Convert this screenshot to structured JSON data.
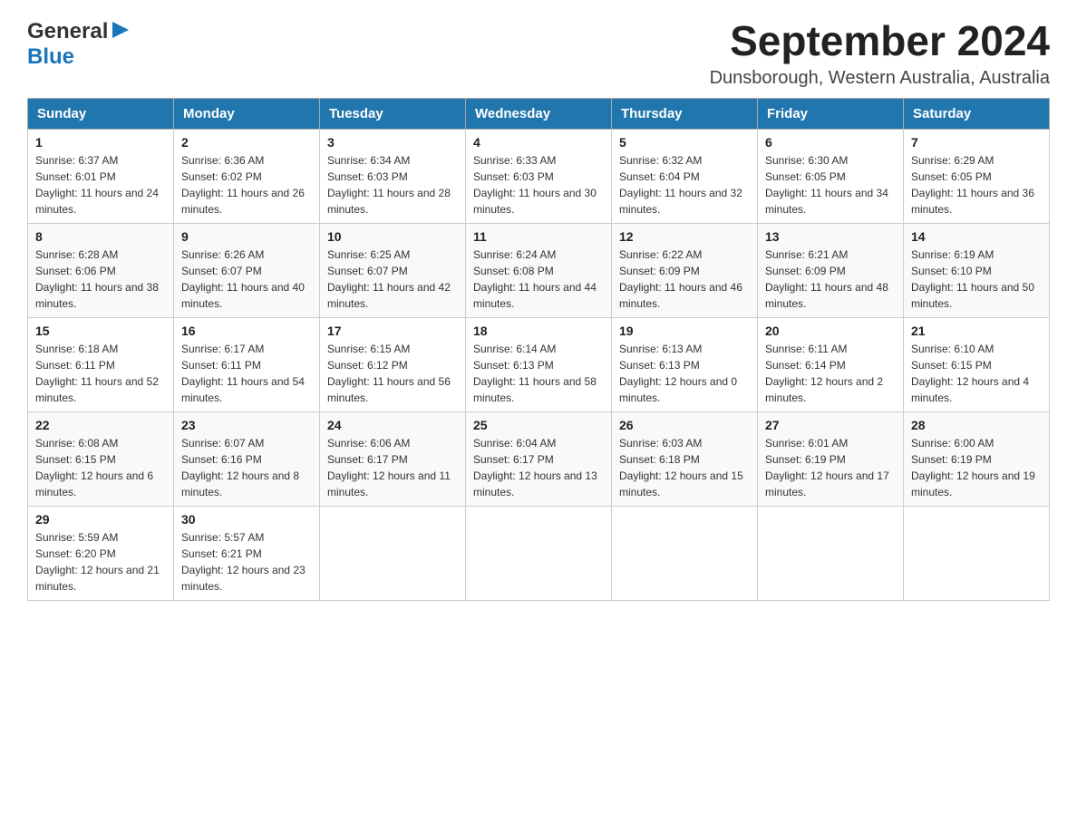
{
  "header": {
    "logo_general": "General",
    "logo_blue": "Blue",
    "title": "September 2024",
    "subtitle": "Dunsborough, Western Australia, Australia"
  },
  "weekdays": [
    "Sunday",
    "Monday",
    "Tuesday",
    "Wednesday",
    "Thursday",
    "Friday",
    "Saturday"
  ],
  "weeks": [
    [
      {
        "day": "1",
        "sunrise": "6:37 AM",
        "sunset": "6:01 PM",
        "daylight": "11 hours and 24 minutes."
      },
      {
        "day": "2",
        "sunrise": "6:36 AM",
        "sunset": "6:02 PM",
        "daylight": "11 hours and 26 minutes."
      },
      {
        "day": "3",
        "sunrise": "6:34 AM",
        "sunset": "6:03 PM",
        "daylight": "11 hours and 28 minutes."
      },
      {
        "day": "4",
        "sunrise": "6:33 AM",
        "sunset": "6:03 PM",
        "daylight": "11 hours and 30 minutes."
      },
      {
        "day": "5",
        "sunrise": "6:32 AM",
        "sunset": "6:04 PM",
        "daylight": "11 hours and 32 minutes."
      },
      {
        "day": "6",
        "sunrise": "6:30 AM",
        "sunset": "6:05 PM",
        "daylight": "11 hours and 34 minutes."
      },
      {
        "day": "7",
        "sunrise": "6:29 AM",
        "sunset": "6:05 PM",
        "daylight": "11 hours and 36 minutes."
      }
    ],
    [
      {
        "day": "8",
        "sunrise": "6:28 AM",
        "sunset": "6:06 PM",
        "daylight": "11 hours and 38 minutes."
      },
      {
        "day": "9",
        "sunrise": "6:26 AM",
        "sunset": "6:07 PM",
        "daylight": "11 hours and 40 minutes."
      },
      {
        "day": "10",
        "sunrise": "6:25 AM",
        "sunset": "6:07 PM",
        "daylight": "11 hours and 42 minutes."
      },
      {
        "day": "11",
        "sunrise": "6:24 AM",
        "sunset": "6:08 PM",
        "daylight": "11 hours and 44 minutes."
      },
      {
        "day": "12",
        "sunrise": "6:22 AM",
        "sunset": "6:09 PM",
        "daylight": "11 hours and 46 minutes."
      },
      {
        "day": "13",
        "sunrise": "6:21 AM",
        "sunset": "6:09 PM",
        "daylight": "11 hours and 48 minutes."
      },
      {
        "day": "14",
        "sunrise": "6:19 AM",
        "sunset": "6:10 PM",
        "daylight": "11 hours and 50 minutes."
      }
    ],
    [
      {
        "day": "15",
        "sunrise": "6:18 AM",
        "sunset": "6:11 PM",
        "daylight": "11 hours and 52 minutes."
      },
      {
        "day": "16",
        "sunrise": "6:17 AM",
        "sunset": "6:11 PM",
        "daylight": "11 hours and 54 minutes."
      },
      {
        "day": "17",
        "sunrise": "6:15 AM",
        "sunset": "6:12 PM",
        "daylight": "11 hours and 56 minutes."
      },
      {
        "day": "18",
        "sunrise": "6:14 AM",
        "sunset": "6:13 PM",
        "daylight": "11 hours and 58 minutes."
      },
      {
        "day": "19",
        "sunrise": "6:13 AM",
        "sunset": "6:13 PM",
        "daylight": "12 hours and 0 minutes."
      },
      {
        "day": "20",
        "sunrise": "6:11 AM",
        "sunset": "6:14 PM",
        "daylight": "12 hours and 2 minutes."
      },
      {
        "day": "21",
        "sunrise": "6:10 AM",
        "sunset": "6:15 PM",
        "daylight": "12 hours and 4 minutes."
      }
    ],
    [
      {
        "day": "22",
        "sunrise": "6:08 AM",
        "sunset": "6:15 PM",
        "daylight": "12 hours and 6 minutes."
      },
      {
        "day": "23",
        "sunrise": "6:07 AM",
        "sunset": "6:16 PM",
        "daylight": "12 hours and 8 minutes."
      },
      {
        "day": "24",
        "sunrise": "6:06 AM",
        "sunset": "6:17 PM",
        "daylight": "12 hours and 11 minutes."
      },
      {
        "day": "25",
        "sunrise": "6:04 AM",
        "sunset": "6:17 PM",
        "daylight": "12 hours and 13 minutes."
      },
      {
        "day": "26",
        "sunrise": "6:03 AM",
        "sunset": "6:18 PM",
        "daylight": "12 hours and 15 minutes."
      },
      {
        "day": "27",
        "sunrise": "6:01 AM",
        "sunset": "6:19 PM",
        "daylight": "12 hours and 17 minutes."
      },
      {
        "day": "28",
        "sunrise": "6:00 AM",
        "sunset": "6:19 PM",
        "daylight": "12 hours and 19 minutes."
      }
    ],
    [
      {
        "day": "29",
        "sunrise": "5:59 AM",
        "sunset": "6:20 PM",
        "daylight": "12 hours and 21 minutes."
      },
      {
        "day": "30",
        "sunrise": "5:57 AM",
        "sunset": "6:21 PM",
        "daylight": "12 hours and 23 minutes."
      },
      null,
      null,
      null,
      null,
      null
    ]
  ],
  "labels": {
    "sunrise": "Sunrise:",
    "sunset": "Sunset:",
    "daylight": "Daylight:"
  }
}
